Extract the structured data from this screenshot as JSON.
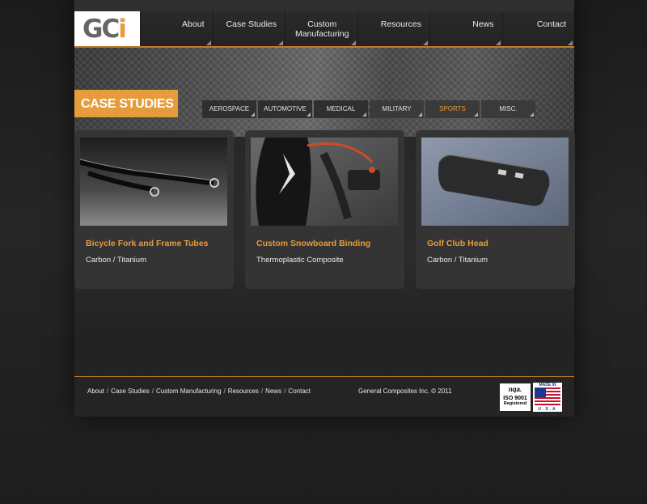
{
  "logo": {
    "text_g": "G",
    "text_c": "C",
    "text_i": "i"
  },
  "nav": [
    {
      "label": "About"
    },
    {
      "label": "Case Studies"
    },
    {
      "label": "Custom\nManufacturing"
    },
    {
      "label": "Resources"
    },
    {
      "label": "News"
    },
    {
      "label": "Contact"
    }
  ],
  "section_title": "CASE STUDIES",
  "tabs": [
    {
      "label": "AEROSPACE"
    },
    {
      "label": "AUTOMOTIVE"
    },
    {
      "label": "MEDICAL"
    },
    {
      "label": "MILITARY"
    },
    {
      "label": "SPORTS"
    },
    {
      "label": "MISC."
    }
  ],
  "cards": [
    {
      "title": "Bicycle Fork and Frame Tubes",
      "subtitle": "Carbon / Titanium"
    },
    {
      "title": "Custom Snowboard Binding",
      "subtitle": "Thermoplastic Composite"
    },
    {
      "title": "Golf Club Head",
      "subtitle": "Carbon / Titanium"
    }
  ],
  "footer": {
    "links": [
      "About",
      "Case Studies",
      "Custom Manufacturing",
      "Resources",
      "News",
      "Contact"
    ],
    "separator": "/",
    "copyright": "General Composites Inc. © 2011",
    "nqa_brand": "nqa.",
    "nqa_line1": "ISO 9001",
    "nqa_line2": "Registered",
    "usa_top": "MADE IN",
    "usa_bottom": "U.S.A"
  },
  "colors": {
    "accent": "#e79c3b",
    "page": "#262626",
    "card": "#343434"
  }
}
